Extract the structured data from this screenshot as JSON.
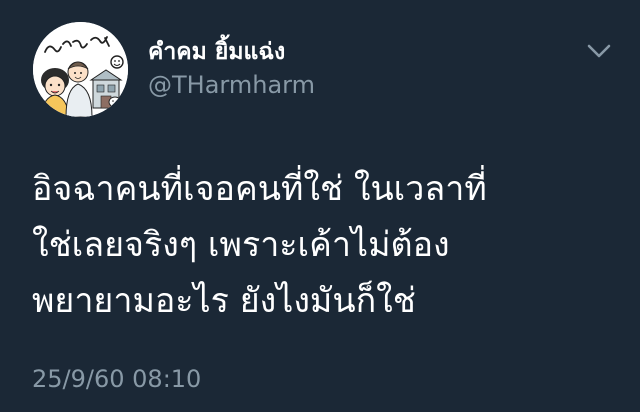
{
  "user": {
    "display_name": "คำคม ยิ้มแฉ่ง",
    "handle": "@THarmharm",
    "avatar_caption": "คำคมยิ้มแฉ่ง"
  },
  "tweet": {
    "lines": [
      "อิจฉาคนที่เจอคนที่ใช่ ในเวลาที่",
      "ใช่เลยจริงๆ เพราะเค้าไม่ต้อง",
      "พยายามอะไร ยังไงมันก็ใช่"
    ],
    "timestamp": "25/9/60 08:10"
  },
  "icons": {
    "menu": "chevron-down-icon"
  },
  "colors": {
    "background": "#1b2836",
    "primary_text": "#ffffff",
    "secondary_text": "#8899a6"
  }
}
